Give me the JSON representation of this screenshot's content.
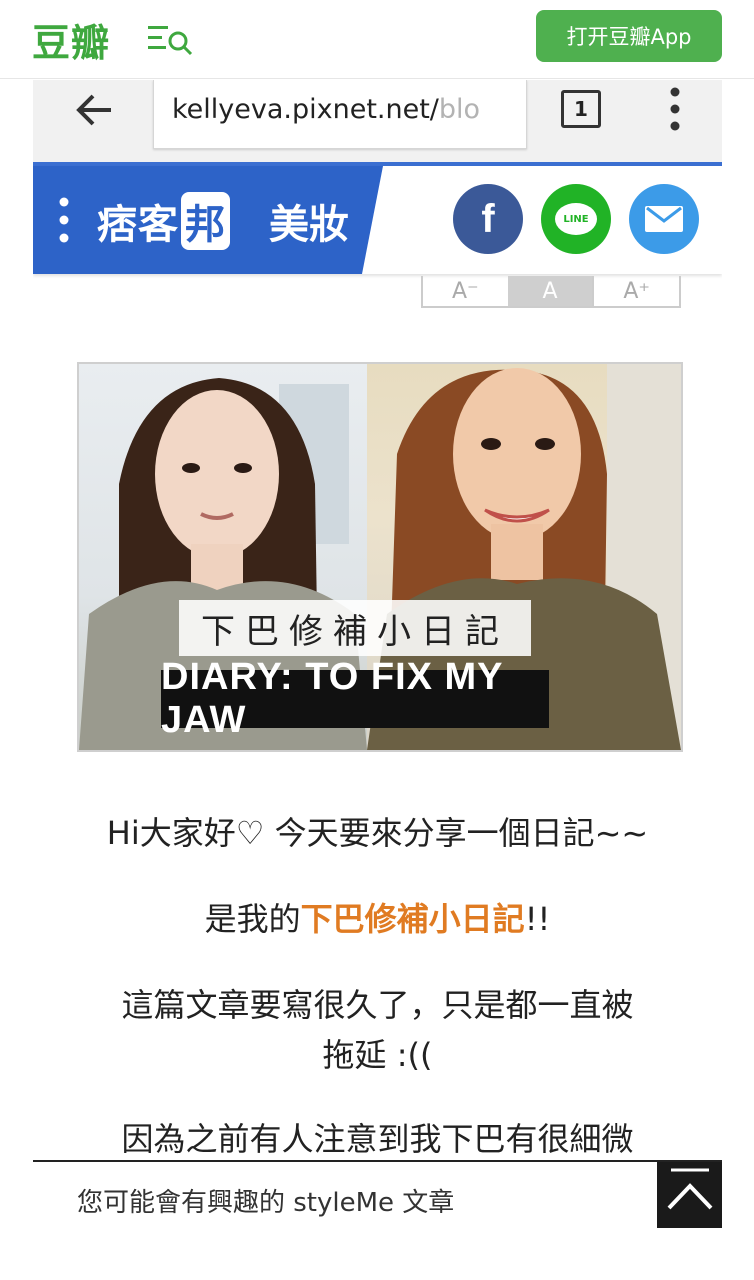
{
  "douban": {
    "logo": "豆瓣",
    "open_app_label": "打开豆瓣App"
  },
  "browser": {
    "url_main": "kellyeva.pixnet.net/",
    "url_faded": "blo",
    "tab_count": "1"
  },
  "pixnet": {
    "logo_pre": "痞客",
    "logo_mark": "邦",
    "category": "美妝",
    "share": {
      "fb_glyph": "f",
      "line_label": "LINE"
    },
    "font_controls": [
      "A⁻",
      "A",
      "A⁺"
    ]
  },
  "hero": {
    "caption_cn": "下巴修補小日記",
    "caption_en": "DIARY: TO FIX MY JAW"
  },
  "article": {
    "p1": "Hi大家好♡ 今天要來分享一個日記~~",
    "p2_pre": "是我的",
    "p2_highlight": "下巴修補小日記",
    "p2_post": "!!",
    "p3_line1": "這篇文章要寫很久了，只是都一直被",
    "p3_line2": "拖延 :((",
    "p4": "因為之前有人注意到我下巴有很細微"
  },
  "recommend": {
    "text": "您可能會有興趣的 styleMe 文章"
  },
  "colors": {
    "douban_green": "#3fa83f",
    "pixnet_blue": "#2d63c8",
    "highlight_orange": "#e07b22"
  }
}
